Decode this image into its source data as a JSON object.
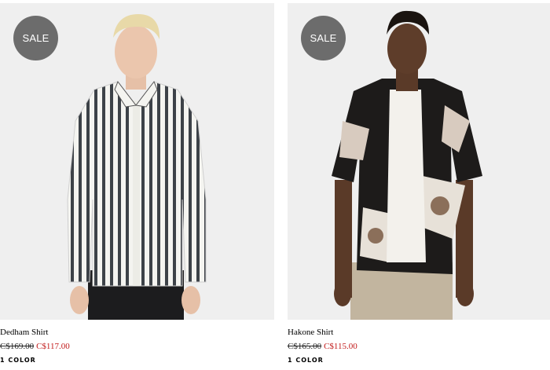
{
  "products": [
    {
      "badge": "SALE",
      "name": "Dedham Shirt",
      "original_price": "C$169.00",
      "sale_price": "C$117.00",
      "colors": "1 COLOR"
    },
    {
      "badge": "SALE",
      "name": "Hakone Shirt",
      "original_price": "C$165.00",
      "sale_price": "C$115.00",
      "colors": "1 COLOR"
    }
  ],
  "colors": {
    "badge_bg": "#6c6c6c",
    "sale_price": "#c21a1a",
    "photo_bg": "#efefef"
  }
}
